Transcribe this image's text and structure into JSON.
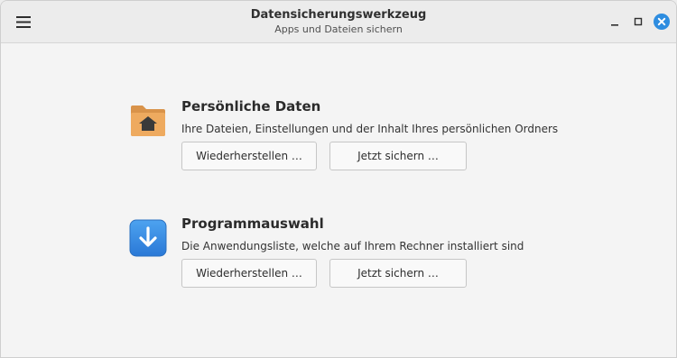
{
  "window": {
    "title": "Datensicherungswerkzeug",
    "subtitle": "Apps und Dateien sichern"
  },
  "sections": [
    {
      "title": "Persönliche Daten",
      "description": "Ihre Dateien, Einstellungen und der Inhalt Ihres persönlichen Ordners",
      "restore_label": "Wiederherstellen …",
      "backup_label": "Jetzt sichern …",
      "icon": "home-folder-icon"
    },
    {
      "title": "Programmauswahl",
      "description": "Die Anwendungsliste, welche auf Ihrem Rechner installiert sind",
      "restore_label": "Wiederherstellen …",
      "backup_label": "Jetzt sichern …",
      "icon": "download-arrow-icon"
    }
  ],
  "colors": {
    "folder": "#e9a65a",
    "folder_back": "#d9934a",
    "app_icon_blue": "#3a8ee6",
    "close_button": "#2e8de0"
  }
}
